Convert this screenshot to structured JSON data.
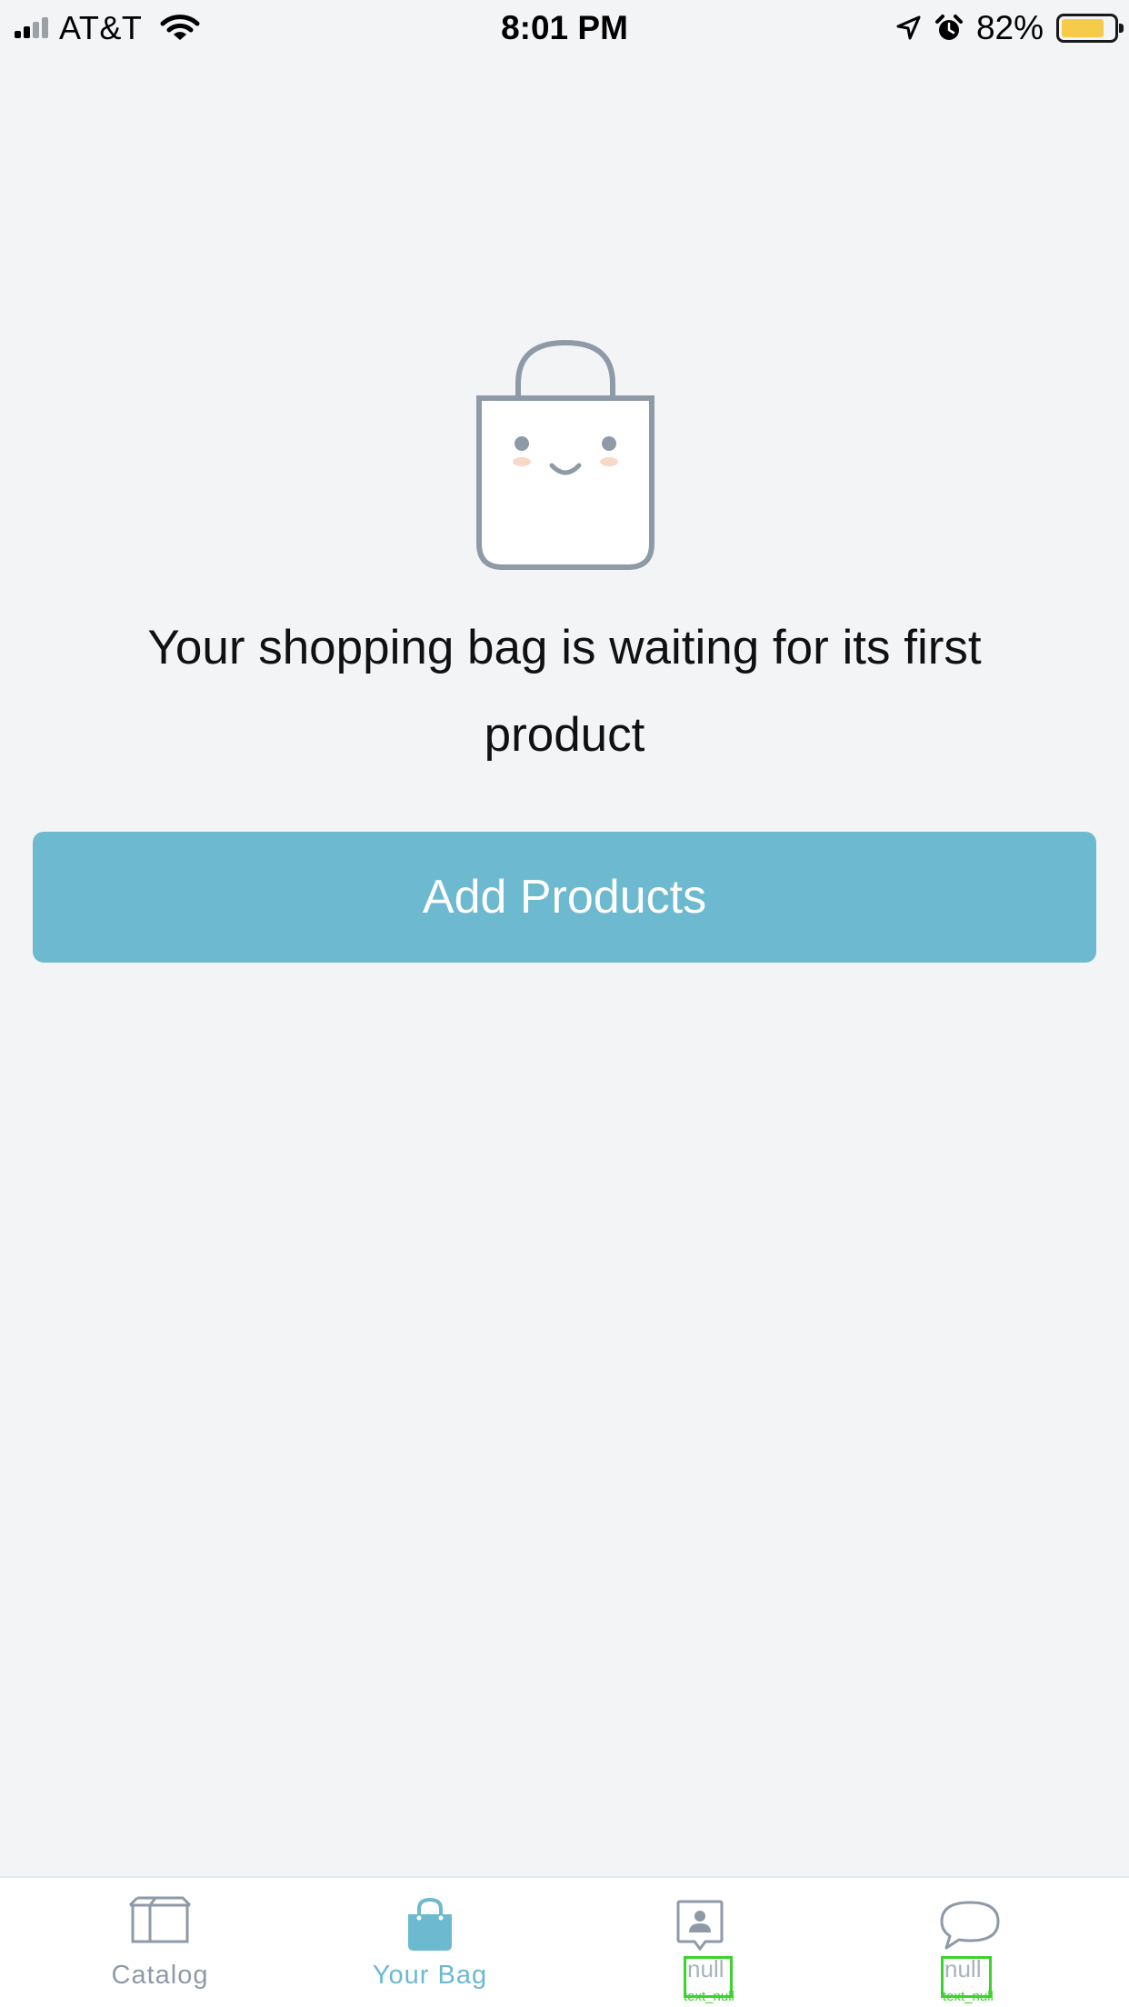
{
  "status_bar": {
    "carrier": "AT&T",
    "time": "8:01 PM",
    "battery_percent": "82%",
    "battery_level": 0.82,
    "icons": [
      "signal-icon",
      "wifi-icon",
      "location-arrow-icon",
      "alarm-icon",
      "battery-icon"
    ]
  },
  "empty_state": {
    "illustration": "smiling-shopping-bag-icon",
    "message": "Your shopping bag is waiting for its first product",
    "button_label": "Add Products"
  },
  "tab_bar": {
    "active_tab": "Your Bag",
    "tabs": [
      {
        "label": "Catalog",
        "icon": "box-icon"
      },
      {
        "label": "Your Bag",
        "icon": "bag-icon"
      },
      {
        "label": "null",
        "caption": "text_null",
        "icon": "contact-card-icon"
      },
      {
        "label": "null",
        "caption": "text_null",
        "icon": "chat-bubble-icon"
      }
    ]
  },
  "colors": {
    "background": "#f3f4f6",
    "accent": "#6cb9d0",
    "icon_gray": "#8e9aa7",
    "battery_fill": "#f5cb49",
    "debug_outline": "#3bd42b"
  }
}
